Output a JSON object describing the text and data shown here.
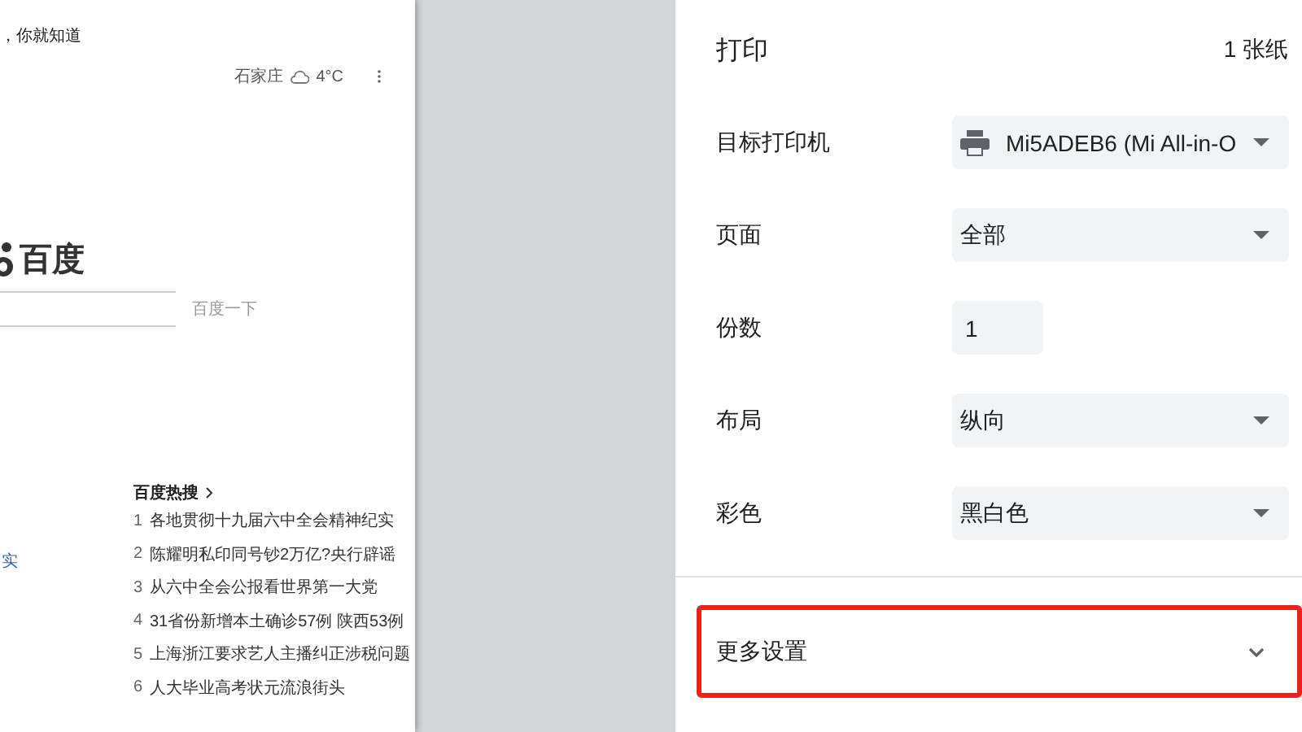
{
  "preview": {
    "tagline": "，你就知道",
    "weather": {
      "city": "石家庄",
      "temperature": "4°C"
    },
    "logo": "百度",
    "search_button": "百度一下",
    "side_fragment": "实",
    "hot_list": {
      "title": "百度热搜",
      "items": [
        {
          "rank": "1",
          "text": "各地贯彻十九届六中全会精神纪实"
        },
        {
          "rank": "2",
          "text": "陈耀明私印同号钞2万亿?央行辟谣"
        },
        {
          "rank": "3",
          "text": "从六中全会公报看世界第一大党"
        },
        {
          "rank": "4",
          "text": "31省份新增本土确诊57例 陕西53例"
        },
        {
          "rank": "5",
          "text": "上海浙江要求艺人主播纠正涉税问题"
        },
        {
          "rank": "6",
          "text": "人大毕业高考状元流浪街头"
        }
      ]
    }
  },
  "print_panel": {
    "title": "打印",
    "sheet_count": "1 张纸",
    "settings": [
      {
        "kind": "printer-select",
        "label": "目标打印机",
        "value": "Mi5ADEB6 (Mi All-in-O"
      },
      {
        "kind": "select",
        "label": "页面",
        "value": "全部"
      },
      {
        "kind": "input",
        "label": "份数",
        "value": "1"
      },
      {
        "kind": "select",
        "label": "布局",
        "value": "纵向"
      },
      {
        "kind": "select",
        "label": "彩色",
        "value": "黑白色"
      }
    ],
    "more_settings": {
      "label": "更多设置",
      "expanded": false,
      "highlighted": true
    }
  }
}
